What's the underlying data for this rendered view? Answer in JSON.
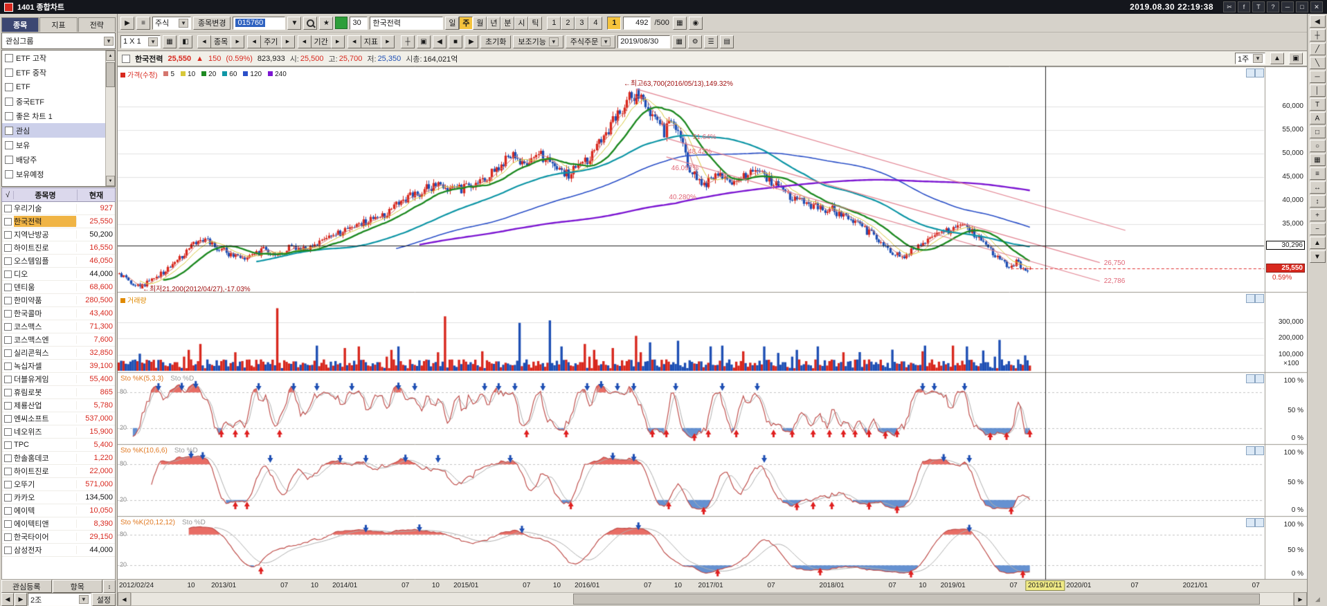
{
  "window": {
    "title": "1401 종합차트",
    "timestamp": "2019.08.30 22:19:38",
    "controls": [
      {
        "g": "✂",
        "n": "capture-icon"
      },
      {
        "g": "f",
        "n": "function-icon"
      },
      {
        "g": "T",
        "n": "font-size-icon"
      },
      {
        "g": "?",
        "n": "help-icon"
      },
      {
        "g": "─",
        "n": "minimize-icon"
      },
      {
        "g": "□",
        "n": "maximize-icon"
      },
      {
        "g": "✕",
        "n": "close-icon"
      }
    ]
  },
  "toolbar1": {
    "asset_type": "주식",
    "change_button": "종목변경",
    "code": "015760",
    "count_box": "30",
    "name": "한국전력",
    "periods": [
      "일",
      "주",
      "월",
      "년",
      "분",
      "시",
      "틱"
    ],
    "active_period": "주",
    "intervals": [
      "1",
      "2",
      "3",
      "4"
    ],
    "interval_active": "1",
    "bars_count": "492",
    "bars_max": "/500"
  },
  "toolbar2": {
    "layout": "1 X 1",
    "nav_groups": [
      "종목",
      "주기",
      "기간",
      "지표"
    ],
    "reset_button": "초기화",
    "aux_button": "보조기능",
    "order_button": "주식주문",
    "date": "2019/08/30"
  },
  "sidebar": {
    "tabs": [
      "종목",
      "지표",
      "전략"
    ],
    "active_tab": "종목",
    "group_label": "관심그룹",
    "groups": [
      "ETF 고작",
      "ETF 중작",
      "ETF",
      "중국ETF",
      "좋은 차트 1",
      "관심",
      "보유",
      "배당주",
      "보유예정"
    ],
    "selected_group": "관심",
    "check_header": "√",
    "headers": [
      "종목명",
      "현재"
    ],
    "rows": [
      {
        "name": "우리기술",
        "price": "927",
        "color": "red"
      },
      {
        "name": "한국전력",
        "price": "25,550",
        "color": "red"
      },
      {
        "name": "지역난방공",
        "price": "50,200",
        "color": "black"
      },
      {
        "name": "하이트진로",
        "price": "16,550",
        "color": "red"
      },
      {
        "name": "오스템임플",
        "price": "46,050",
        "color": "red"
      },
      {
        "name": "디오",
        "price": "44,000",
        "color": "black"
      },
      {
        "name": "덴티움",
        "price": "68,600",
        "color": "red"
      },
      {
        "name": "한미약품",
        "price": "280,500",
        "color": "red"
      },
      {
        "name": "한국콜마",
        "price": "43,400",
        "color": "red"
      },
      {
        "name": "코스맥스",
        "price": "71,300",
        "color": "red"
      },
      {
        "name": "코스맥스엔",
        "price": "7,600",
        "color": "red"
      },
      {
        "name": "실리콘웍스",
        "price": "32,850",
        "color": "red"
      },
      {
        "name": "녹십자셀",
        "price": "39,100",
        "color": "red"
      },
      {
        "name": "더블유게임",
        "price": "55,400",
        "color": "red"
      },
      {
        "name": "휴림로봇",
        "price": "865",
        "color": "red"
      },
      {
        "name": "제룡산업",
        "price": "5,780",
        "color": "red"
      },
      {
        "name": "엔씨소프트",
        "price": "537,000",
        "color": "red"
      },
      {
        "name": "네오위즈",
        "price": "15,900",
        "color": "red"
      },
      {
        "name": "TPC",
        "price": "5,400",
        "color": "red"
      },
      {
        "name": "한솔홈데코",
        "price": "1,220",
        "color": "red"
      },
      {
        "name": "하이트진로",
        "price": "22,000",
        "color": "red"
      },
      {
        "name": "오뚜기",
        "price": "571,000",
        "color": "red"
      },
      {
        "name": "카카오",
        "price": "134,500",
        "color": "black"
      },
      {
        "name": "에이텍",
        "price": "10,050",
        "color": "red"
      },
      {
        "name": "에이텍티앤",
        "price": "8,390",
        "color": "red"
      },
      {
        "name": "한국타이어",
        "price": "29,150",
        "color": "red"
      },
      {
        "name": "삼성전자",
        "price": "44,000",
        "color": "black"
      }
    ],
    "selected_row": "한국전력",
    "register_button": "관심등록",
    "item_button": "항목",
    "preset": "2조",
    "settings_button": "설정"
  },
  "quote": {
    "name": "한국전력",
    "price": "25,550",
    "change_arrow": "▲",
    "change": "150",
    "change_pct": "(0.59%)",
    "volume": "823,933",
    "open_label": "시:",
    "open": "25,500",
    "high_label": "고:",
    "high": "25,700",
    "low_label": "저:",
    "low": "25,350",
    "cap_label": "시총:",
    "cap": "164,021억",
    "range_badge": "1주"
  },
  "legend": {
    "price_label": "가격(수정)",
    "price_color": "#d8281e",
    "mas": [
      {
        "label": "5",
        "color": "#d4766e"
      },
      {
        "label": "10",
        "color": "#d8c83a"
      },
      {
        "label": "20",
        "color": "#1e8a22"
      },
      {
        "label": "60",
        "color": "#0e96a6"
      },
      {
        "label": "120",
        "color": "#2b50c8"
      },
      {
        "label": "240",
        "color": "#7c16d2"
      }
    ]
  },
  "price_axis": {
    "labels": [
      "60,000",
      "55,000",
      "50,000",
      "45,000",
      "40,000",
      "35,000"
    ],
    "values": [
      60000,
      55000,
      50000,
      45000,
      40000,
      35000
    ]
  },
  "volume_panel": {
    "title": "거래량",
    "color": "#e08a00",
    "axis_labels": [
      "300,000",
      "200,000",
      "100,000"
    ],
    "axis_values": [
      300000,
      200000,
      100000
    ],
    "unit": "×100"
  },
  "sto_panels": [
    {
      "k_label": "Sto %K(5,3,3)",
      "d_label": "Sto %D",
      "n": 5,
      "m": 3,
      "l": 3,
      "left_labels": [
        "80",
        "20"
      ],
      "right_labels": [
        "100 %",
        "50 %",
        "0 %"
      ]
    },
    {
      "k_label": "Sto %K(10,6,6)",
      "d_label": "Sto %D",
      "n": 10,
      "m": 6,
      "l": 6,
      "left_labels": [
        "80",
        "20"
      ],
      "right_labels": [
        "100 %",
        "50 %",
        "0 %"
      ]
    },
    {
      "k_label": "Sto %K(20,12,12)",
      "d_label": "Sto %D",
      "n": 20,
      "m": 12,
      "l": 12,
      "left_labels": [
        "80",
        "20"
      ],
      "right_labels": [
        "100 %",
        "50 %",
        "0 %"
      ]
    }
  ],
  "annotations": {
    "high_label": "←최고63,700(2016/05/13),149.32%",
    "high_week": 222,
    "high_price": 63700,
    "low_label": "←최저21,200(2012/04/27),-17.03%",
    "low_week": 9,
    "low_price": 21200,
    "trend_labels": [
      {
        "text": "51.64%",
        "week": 257,
        "price": 53450
      },
      {
        "text": "48.42%",
        "week": 255,
        "price": 50370
      },
      {
        "text": "46.097%",
        "week": 249,
        "price": 46890
      },
      {
        "text": "40.280%",
        "week": 248,
        "price": 40740
      }
    ],
    "channel_price_labels": [
      {
        "text": "26,750",
        "week": 421,
        "price": 26750
      },
      {
        "text": "22,786",
        "week": 421,
        "price": 22786
      }
    ],
    "crosshair": {
      "week": 397.5,
      "price": 30296,
      "price_label": "30,296",
      "date_label": "2019/10/11"
    },
    "current": {
      "price": 25550,
      "price_label": "25,550",
      "pct_label": "0.59%"
    }
  },
  "x_axis": {
    "ticks": [
      [
        0,
        "2012/02/24"
      ],
      [
        31,
        "10"
      ],
      [
        45,
        "2013/01"
      ],
      [
        71,
        "07"
      ],
      [
        84,
        "10"
      ],
      [
        97,
        "2014/01"
      ],
      [
        123,
        "07"
      ],
      [
        136,
        "10"
      ],
      [
        149,
        "2015/01"
      ],
      [
        175,
        "07"
      ],
      [
        188,
        "10"
      ],
      [
        201,
        "2016/01"
      ],
      [
        227,
        "07"
      ],
      [
        240,
        "10"
      ],
      [
        254,
        "2017/01"
      ],
      [
        280,
        "07"
      ],
      [
        306,
        "2018/01"
      ],
      [
        332,
        "07"
      ],
      [
        345,
        "10"
      ],
      [
        358,
        "2019/01"
      ],
      [
        384,
        "07"
      ],
      [
        412,
        "2020/01"
      ],
      [
        436,
        "07"
      ],
      [
        462,
        "2021/01"
      ],
      [
        488,
        "07"
      ]
    ]
  },
  "right_tools": [
    {
      "g": "◀",
      "n": "collapse-panel-icon"
    },
    {
      "g": "┼",
      "n": "crosshair-tool-icon"
    },
    {
      "g": "╱",
      "n": "uptrend-line-tool-icon"
    },
    {
      "g": "╲",
      "n": "downtrend-line-tool-icon"
    },
    {
      "g": "─",
      "n": "horizontal-line-tool-icon"
    },
    {
      "g": "│",
      "n": "vertical-line-tool-icon"
    },
    {
      "g": "T",
      "n": "text-tool-icon"
    },
    {
      "g": "A",
      "n": "font-tool-icon"
    },
    {
      "g": "□",
      "n": "rectangle-tool-icon"
    },
    {
      "g": "○",
      "n": "ellipse-tool-icon"
    },
    {
      "g": "▦",
      "n": "grid-tool-icon"
    },
    {
      "g": "≡",
      "n": "indicator-list-icon"
    },
    {
      "g": "↔",
      "n": "pan-horizontal-icon"
    },
    {
      "g": "↕",
      "n": "pan-vertical-icon"
    },
    {
      "g": "+",
      "n": "zoom-in-icon"
    },
    {
      "g": "−",
      "n": "zoom-out-icon"
    },
    {
      "g": "▲",
      "n": "scroll-up-icon"
    },
    {
      "g": "▼",
      "n": "scroll-down-icon"
    }
  ],
  "chart_data": {
    "type": "candlestick",
    "symbol": "한국전력",
    "code": "015760",
    "timeframe": "weekly",
    "visible_bars": 492,
    "data_bars": 392,
    "y_range": [
      20500,
      68500
    ],
    "volume_max": 400000,
    "price_anchors": [
      [
        0,
        24300
      ],
      [
        5,
        22600
      ],
      [
        9,
        21400
      ],
      [
        15,
        23600
      ],
      [
        22,
        25600
      ],
      [
        31,
        30200
      ],
      [
        36,
        31600
      ],
      [
        42,
        30000
      ],
      [
        48,
        28400
      ],
      [
        55,
        27400
      ],
      [
        62,
        29400
      ],
      [
        68,
        28200
      ],
      [
        74,
        30400
      ],
      [
        80,
        29200
      ],
      [
        86,
        31200
      ],
      [
        92,
        32400
      ],
      [
        97,
        33400
      ],
      [
        104,
        35300
      ],
      [
        112,
        36200
      ],
      [
        118,
        38500
      ],
      [
        123,
        40200
      ],
      [
        129,
        41600
      ],
      [
        136,
        43400
      ],
      [
        142,
        42000
      ],
      [
        149,
        42600
      ],
      [
        156,
        44300
      ],
      [
        163,
        47200
      ],
      [
        169,
        49400
      ],
      [
        175,
        47200
      ],
      [
        180,
        49800
      ],
      [
        186,
        47400
      ],
      [
        193,
        45600
      ],
      [
        201,
        48600
      ],
      [
        207,
        52500
      ],
      [
        212,
        56500
      ],
      [
        217,
        60500
      ],
      [
        222,
        63000
      ],
      [
        226,
        60000
      ],
      [
        230,
        56500
      ],
      [
        234,
        54600
      ],
      [
        238,
        56800
      ],
      [
        241,
        53500
      ],
      [
        244,
        47800
      ],
      [
        248,
        44600
      ],
      [
        252,
        43400
      ],
      [
        258,
        45700
      ],
      [
        263,
        43100
      ],
      [
        269,
        45100
      ],
      [
        275,
        46400
      ],
      [
        281,
        43600
      ],
      [
        287,
        41100
      ],
      [
        293,
        39600
      ],
      [
        299,
        38400
      ],
      [
        306,
        37900
      ],
      [
        312,
        36400
      ],
      [
        318,
        34400
      ],
      [
        324,
        32400
      ],
      [
        330,
        29600
      ],
      [
        336,
        27900
      ],
      [
        341,
        29300
      ],
      [
        347,
        31600
      ],
      [
        353,
        33100
      ],
      [
        358,
        33600
      ],
      [
        362,
        35100
      ],
      [
        366,
        33400
      ],
      [
        370,
        31300
      ],
      [
        374,
        29300
      ],
      [
        378,
        27400
      ],
      [
        382,
        25400
      ],
      [
        385,
        26900
      ],
      [
        388,
        25100
      ],
      [
        391,
        25550
      ]
    ],
    "volume_spikes": [
      [
        35,
        165000
      ],
      [
        68,
        385000
      ],
      [
        97,
        140000
      ],
      [
        120,
        150000
      ],
      [
        140,
        335000
      ],
      [
        156,
        120000
      ],
      [
        172,
        295000
      ],
      [
        185,
        310000
      ],
      [
        200,
        165000
      ],
      [
        212,
        140000
      ],
      [
        222,
        215000
      ],
      [
        228,
        175000
      ],
      [
        240,
        185000
      ],
      [
        254,
        150000
      ],
      [
        268,
        120000
      ],
      [
        283,
        110000
      ],
      [
        300,
        150000
      ],
      [
        318,
        115000
      ],
      [
        332,
        130000
      ],
      [
        345,
        120000
      ],
      [
        358,
        155000
      ],
      [
        371,
        125000
      ],
      [
        378,
        190000
      ],
      [
        389,
        95000
      ]
    ],
    "channel_lines": [
      [
        235,
        53200,
        421,
        26750
      ],
      [
        235,
        49236,
        421,
        22786
      ],
      [
        222,
        63700,
        432,
        33600
      ]
    ]
  }
}
